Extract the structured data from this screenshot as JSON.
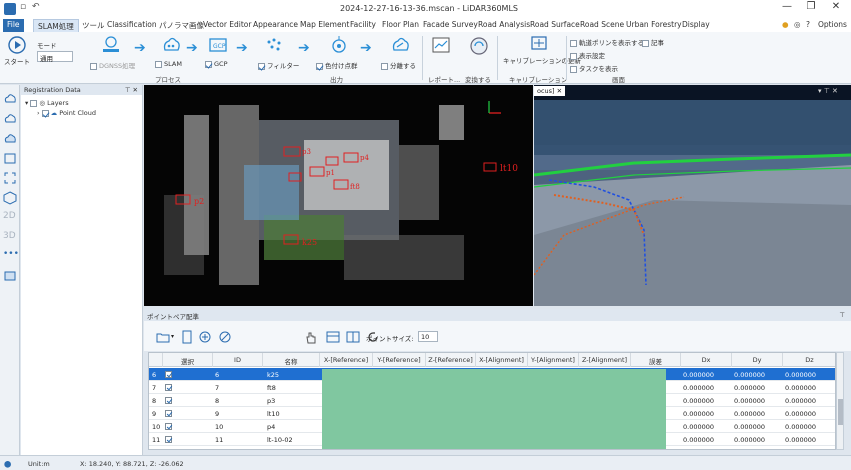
{
  "titlebar": {
    "title": "2024-12-27-16-13-36.mscan - LiDAR360MLS",
    "minimize": "—",
    "restore": "❐",
    "close": "✕"
  },
  "menubar": {
    "file": "File",
    "tabs": [
      "SLAM処理",
      "ツール",
      "Classification",
      "パノラマ画像",
      "Vector Editor",
      "Appearance",
      "Map Element",
      "Facility",
      "Floor Plan",
      "Facade Survey",
      "Road Analysis",
      "Road Surface",
      "Road Scene",
      "Urban Forestry",
      "Display"
    ],
    "active_tab": "SLAM処理",
    "options": "Options"
  },
  "ribbon": {
    "start_label": "スタート",
    "mode_label": "モード",
    "mode_value": "通用",
    "dgnss_label": "DGNSS処理",
    "slam_label": "SLAM",
    "gcp_label": "GCP",
    "filter_label": "フィルター",
    "color_label": "色付け点群",
    "split_label": "分離する",
    "group_process": "プロセス",
    "group_output": "出力",
    "report_label": "レポート...",
    "convert_label": "変換する",
    "calib_update_label": "キャリブレーションの更新",
    "group_calib": "キャリブレーション",
    "opt_traj": "軌道ポリンを表示する",
    "opt_memo": "記事",
    "opt_display_settings": "表示設定",
    "opt_task": "タスクを表示",
    "group_screen": "画面"
  },
  "left_panel": {
    "title": "Registration Data",
    "layers": "Layers",
    "point_cloud": "Point Cloud"
  },
  "views": {
    "right_tab": "ocus]",
    "markers": [
      "lt10",
      "p3",
      "k25",
      "p2",
      "p1",
      "ft8",
      "p4"
    ]
  },
  "bottom_panel": {
    "title": "ポイントペア配準",
    "point_size_label": "ポイントサイズ:",
    "point_size_value": "10",
    "columns": [
      "選択",
      "ID",
      "名称",
      "X-[Reference]",
      "Y-[Reference]",
      "Z-[Reference]",
      "X-[Alignment]",
      "Y-[Alignment]",
      "Z-[Alignment]",
      "誤差",
      "Dx",
      "Dy",
      "Dz"
    ],
    "rows": [
      {
        "n": "6",
        "id": "6",
        "name": "k25",
        "dx": "0.000000",
        "dy": "0.000000",
        "dz": "0.000000",
        "selected": true
      },
      {
        "n": "7",
        "id": "7",
        "name": "ft8",
        "dx": "0.000000",
        "dy": "0.000000",
        "dz": "0.000000",
        "selected": false
      },
      {
        "n": "8",
        "id": "8",
        "name": "p3",
        "dx": "0.000000",
        "dy": "0.000000",
        "dz": "0.000000",
        "selected": false
      },
      {
        "n": "9",
        "id": "9",
        "name": "lt10",
        "dx": "0.000000",
        "dy": "0.000000",
        "dz": "0.000000",
        "selected": false
      },
      {
        "n": "10",
        "id": "10",
        "name": "p4",
        "dx": "0.000000",
        "dy": "0.000000",
        "dz": "0.000000",
        "selected": false
      },
      {
        "n": "11",
        "id": "11",
        "name": "lt-10-02",
        "dx": "0.000000",
        "dy": "0.000000",
        "dz": "0.000000",
        "selected": false
      }
    ]
  },
  "statusbar": {
    "units": "Unit:m",
    "coords": "X: 18.240, Y: 88.721, Z: -26.062"
  },
  "colors": {
    "accent": "#2b6cb0",
    "selection": "#1f6fd1",
    "overlay": "#80c7a0",
    "marker": "#e02020"
  }
}
